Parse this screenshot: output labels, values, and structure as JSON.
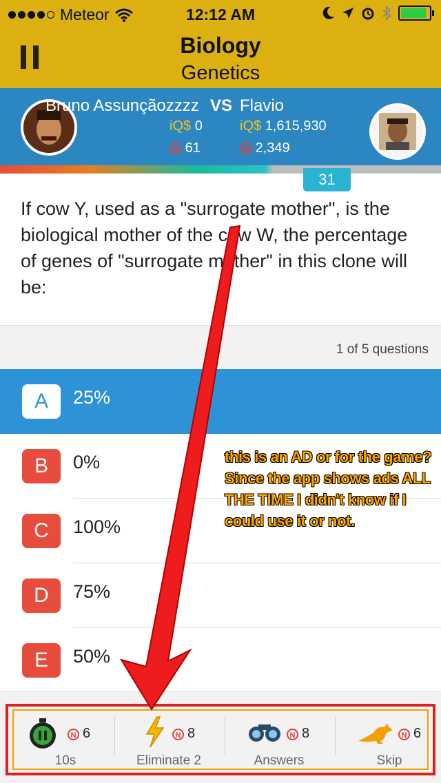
{
  "status_bar": {
    "carrier": "Meteor",
    "time": "12:12 AM"
  },
  "header": {
    "subject": "Biology",
    "topic": "Genetics"
  },
  "players": {
    "left": {
      "name": "Bruno Assunçãozzzz",
      "iq_label": "iQ$",
      "iq_value": "0",
      "coins": "61"
    },
    "vs": "VS",
    "right": {
      "name": "Flavio",
      "iq_label": "iQ$",
      "iq_value": "1,615,930",
      "coins": "2,349"
    }
  },
  "timer": "31",
  "question": "If cow Y, used as a \"surrogate mother\", is the biological mother of the cow W, the percentage of genes of \"surrogate mother\" in this clone will be:",
  "progress_text": "1 of 5 questions",
  "answers": [
    {
      "letter": "A",
      "text": "25%",
      "selected": true
    },
    {
      "letter": "B",
      "text": "0%"
    },
    {
      "letter": "C",
      "text": "100%"
    },
    {
      "letter": "D",
      "text": "75%"
    },
    {
      "letter": "E",
      "text": "50%"
    }
  ],
  "annotation": "this is an AD or for the game? Since the app shows ads ALL THE TIME I didn't know if I could use it or not.",
  "powerups": [
    {
      "icon": "stopwatch-icon",
      "count": "6",
      "label": "10s"
    },
    {
      "icon": "lightning-icon",
      "count": "8",
      "label": "Eliminate 2"
    },
    {
      "icon": "binoculars-icon",
      "count": "8",
      "label": "Answers"
    },
    {
      "icon": "kangaroo-icon",
      "count": "6",
      "label": "Skip"
    }
  ],
  "colors": {
    "header": "#dcb010",
    "players_bar": "#2b86c2",
    "selected_answer": "#2e93d6",
    "answer_badge": "#e74c3c",
    "annotation_border": "#e02020"
  }
}
